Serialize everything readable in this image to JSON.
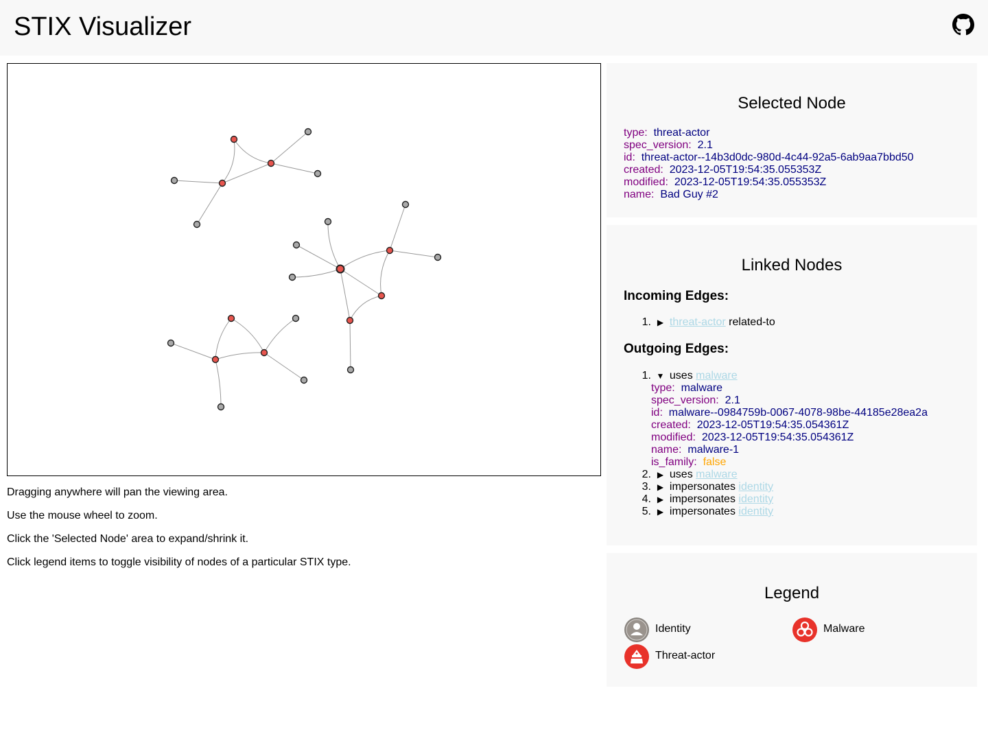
{
  "app": {
    "title": "STIX Visualizer",
    "github_icon": "github-icon"
  },
  "help": [
    "Dragging anywhere will pan the viewing area.",
    "Use the mouse wheel to zoom.",
    "Click the 'Selected Node' area to expand/shrink it.",
    "Click legend items to toggle visibility of nodes of a particular STIX type."
  ],
  "selected": {
    "title": "Selected Node",
    "fields": [
      {
        "k": "type:",
        "v": "threat-actor"
      },
      {
        "k": "spec_version:",
        "v": "2.1"
      },
      {
        "k": "id:",
        "v": "threat-actor--14b3d0dc-980d-4c44-92a5-6ab9aa7bbd50"
      },
      {
        "k": "created:",
        "v": "2023-12-05T19:54:35.055353Z"
      },
      {
        "k": "modified:",
        "v": "2023-12-05T19:54:35.055353Z"
      },
      {
        "k": "name:",
        "v": "Bad Guy #2"
      }
    ]
  },
  "linked": {
    "title": "Linked Nodes",
    "incoming_label": "Incoming Edges:",
    "outgoing_label": "Outgoing Edges:",
    "incoming": [
      {
        "num": "1.",
        "toggle": "▶",
        "link": "threat-actor",
        "rel": "related-to"
      }
    ],
    "outgoing": [
      {
        "num": "1.",
        "toggle": "▼",
        "rel": "uses",
        "link": "malware"
      },
      {
        "num": "2.",
        "toggle": "▶",
        "rel": "uses",
        "link": "malware"
      },
      {
        "num": "3.",
        "toggle": "▶",
        "rel": "impersonates",
        "link": "identity"
      },
      {
        "num": "4.",
        "toggle": "▶",
        "rel": "impersonates",
        "link": "identity"
      },
      {
        "num": "5.",
        "toggle": "▶",
        "rel": "impersonates",
        "link": "identity"
      }
    ],
    "expanded": [
      {
        "k": "type:",
        "v": "malware"
      },
      {
        "k": "spec_version:",
        "v": "2.1"
      },
      {
        "k": "id:",
        "v": "malware--0984759b-0067-4078-98be-44185e28ea2a"
      },
      {
        "k": "created:",
        "v": "2023-12-05T19:54:35.054361Z"
      },
      {
        "k": "modified:",
        "v": "2023-12-05T19:54:35.054361Z"
      },
      {
        "k": "name:",
        "v": "malware-1"
      },
      {
        "k": "is_family:",
        "v": "false"
      }
    ]
  },
  "legend": {
    "title": "Legend",
    "items": [
      {
        "label": "Identity",
        "icon": "identity-icon",
        "color": "#8c8c8c"
      },
      {
        "label": "Malware",
        "icon": "malware-icon",
        "color": "#ee3322"
      },
      {
        "label": "Threat-actor",
        "icon": "threat-actor-icon",
        "color": "#ee3322"
      }
    ]
  },
  "colors": {
    "key": "#800080",
    "value": "#000080",
    "boolean": "#ffa500",
    "link": "#add8e6",
    "panel_bg": "#f8f8f8",
    "node_red": "#e8554e",
    "node_gray": "#aaaaaa"
  }
}
